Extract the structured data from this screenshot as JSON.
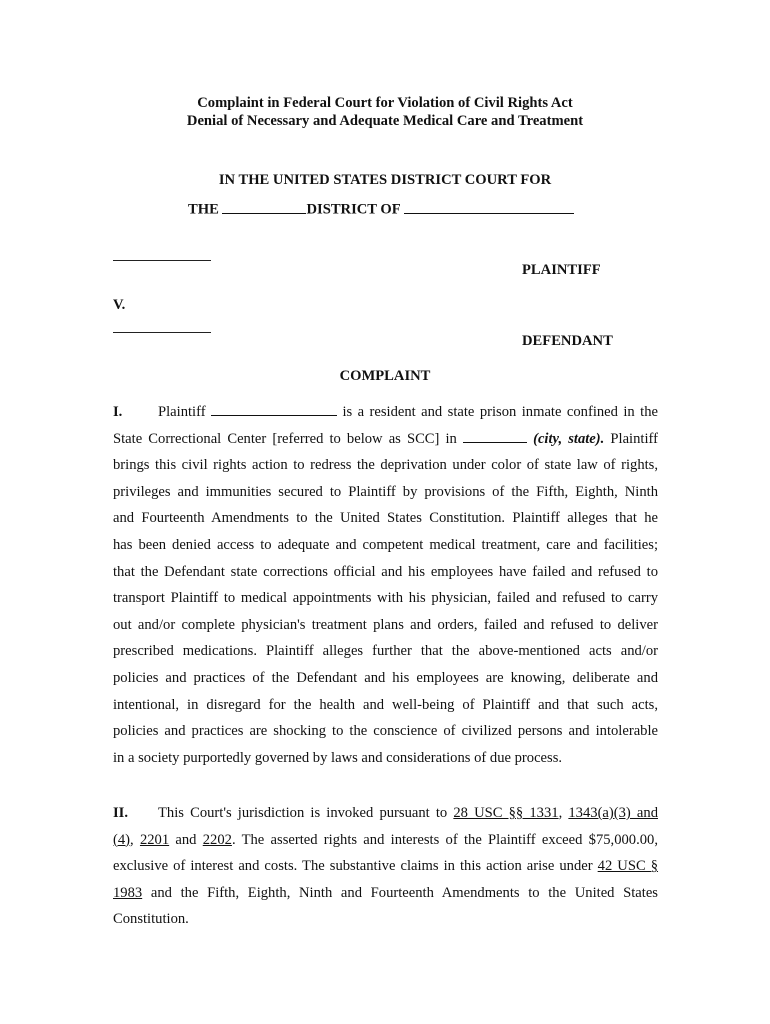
{
  "document": {
    "title_line1": "Complaint in Federal Court for Violation of Civil Rights Act",
    "title_line2": "Denial of Necessary and Adequate Medical Care and Treatment",
    "court_line1": "IN THE UNITED STATES DISTRICT COURT FOR",
    "court_line2_prefix": "THE",
    "court_line2_middle": "DISTRICT OF",
    "plaintiff_label": "PLAINTIFF",
    "versus": "V.",
    "defendant_label": "DEFENDANT",
    "complaint_heading": "COMPLAINT",
    "section1": {
      "number": "I.",
      "l1_a": "Plaintiff",
      "l1_b": "is a resident and state prison inmate confined in the",
      "l2_a": "State Correctional Center [referred to below as SCC] in",
      "l2_italic": "(city, state).",
      "l2_b": "Plaintiff",
      "lines": [
        "brings this civil rights action to redress the deprivation under color of state law of rights,",
        "privileges and immunities secured to Plaintiff by provisions of the Fifth, Eighth, Ninth",
        "and Fourteenth Amendments to the United States Constitution. Plaintiff alleges that he",
        "has been denied access to adequate and competent medical treatment, care and facilities;",
        "that the Defendant state corrections official and his employees have failed and refused to",
        "transport Plaintiff to medical appointments with his physician, failed and refused to carry",
        "out and/or complete physician's treatment plans and orders, failed and refused to deliver",
        "prescribed medications. Plaintiff alleges further that the above-mentioned acts and/or",
        "policies and practices of the Defendant and his employees are knowing, deliberate and",
        "intentional, in disregard for the health and well-being of Plaintiff and that such acts,",
        "policies and practices are shocking to the conscience of civilized persons and intolerable",
        "in a society purportedly governed by laws and considerations of due process."
      ]
    },
    "section2": {
      "number": "II.",
      "l1_a": "This Court's jurisdiction is invoked pursuant to",
      "cite1": "28 USC §§ 1331",
      "comma": ",",
      "cite2": "1343(a)(3) and",
      "cite3": "(4)",
      "l2_a": ",",
      "cite4": "2201",
      "l2_b": "and",
      "cite5": "2202",
      "l2_c": ". The asserted rights and interests of the Plaintiff exceed $75,000.00,",
      "l3_a": "exclusive of interest and costs. The substantive claims in this action arise under",
      "cite6": "42 USC §",
      "cite7": "1983",
      "l4_a": "and the Fifth, Eighth, Ninth and Fourteenth Amendments to the United States",
      "l5": "Constitution."
    }
  }
}
